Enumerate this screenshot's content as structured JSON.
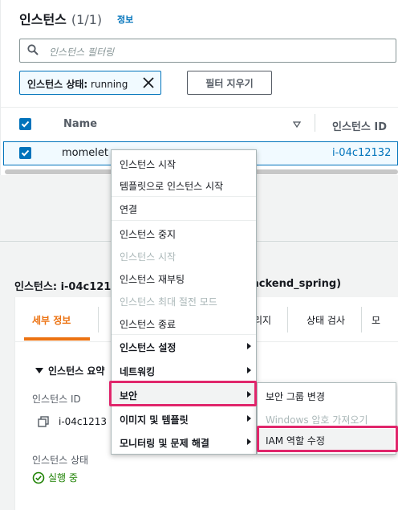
{
  "header": {
    "title": "인스턴스",
    "count": "(1/1)",
    "info_link": "정보"
  },
  "search": {
    "placeholder": "인스턴스 필터링"
  },
  "filter_chip": {
    "key": "인스턴스 상태:",
    "value": "running"
  },
  "clear_filters_label": "필터 지우기",
  "table": {
    "columns": [
      "Name",
      "인스턴스 ID"
    ],
    "rows": [
      {
        "name": "momelet",
        "instance_id": "i-04c12132"
      }
    ]
  },
  "context_menu": {
    "items": [
      {
        "label": "인스턴스 시작",
        "state": "enabled"
      },
      {
        "label": "템플릿으로 인스턴스 시작",
        "state": "enabled"
      },
      {
        "label": "연결",
        "state": "enabled"
      },
      {
        "label": "인스턴스 중지",
        "state": "enabled"
      },
      {
        "label": "인스턴스 시작",
        "state": "disabled"
      },
      {
        "label": "인스턴스 재부팅",
        "state": "enabled"
      },
      {
        "label": "인스턴스 최대 절전 모드",
        "state": "disabled"
      },
      {
        "label": "인스턴스 종료",
        "state": "enabled"
      },
      {
        "label": "인스턴스 설정",
        "state": "submenu"
      },
      {
        "label": "네트워킹",
        "state": "submenu"
      },
      {
        "label": "보안",
        "state": "submenu-open"
      },
      {
        "label": "이미지 및 템플릿",
        "state": "submenu"
      },
      {
        "label": "모니터링 및 문제 해결",
        "state": "submenu"
      }
    ]
  },
  "security_submenu": {
    "items": [
      {
        "label": "보안 그룹 변경",
        "state": "enabled"
      },
      {
        "label": "Windows 암호 가져오기",
        "state": "disabled"
      },
      {
        "label": "IAM 역할 수정",
        "state": "highlighted"
      }
    ]
  },
  "details": {
    "title": "인스턴스: i-04c121",
    "title_tail": "ackend_spring)",
    "tabs": [
      {
        "label": "세부 정보",
        "active": true
      },
      {
        "label": "리지",
        "active": false
      },
      {
        "label": "상태 검사",
        "active": false
      }
    ],
    "summary_label": "인스턴스 요약",
    "instance_id_label": "인스턴스 ID",
    "instance_id_value": "i-04c1213",
    "instance_state_label": "인스턴스 상태",
    "instance_state_value": "실행 중"
  },
  "colors": {
    "primary_blue": "#0073bb",
    "highlight_pink": "#e0266b",
    "active_tab_orange": "#ec7211",
    "running_green": "#1d8102"
  }
}
